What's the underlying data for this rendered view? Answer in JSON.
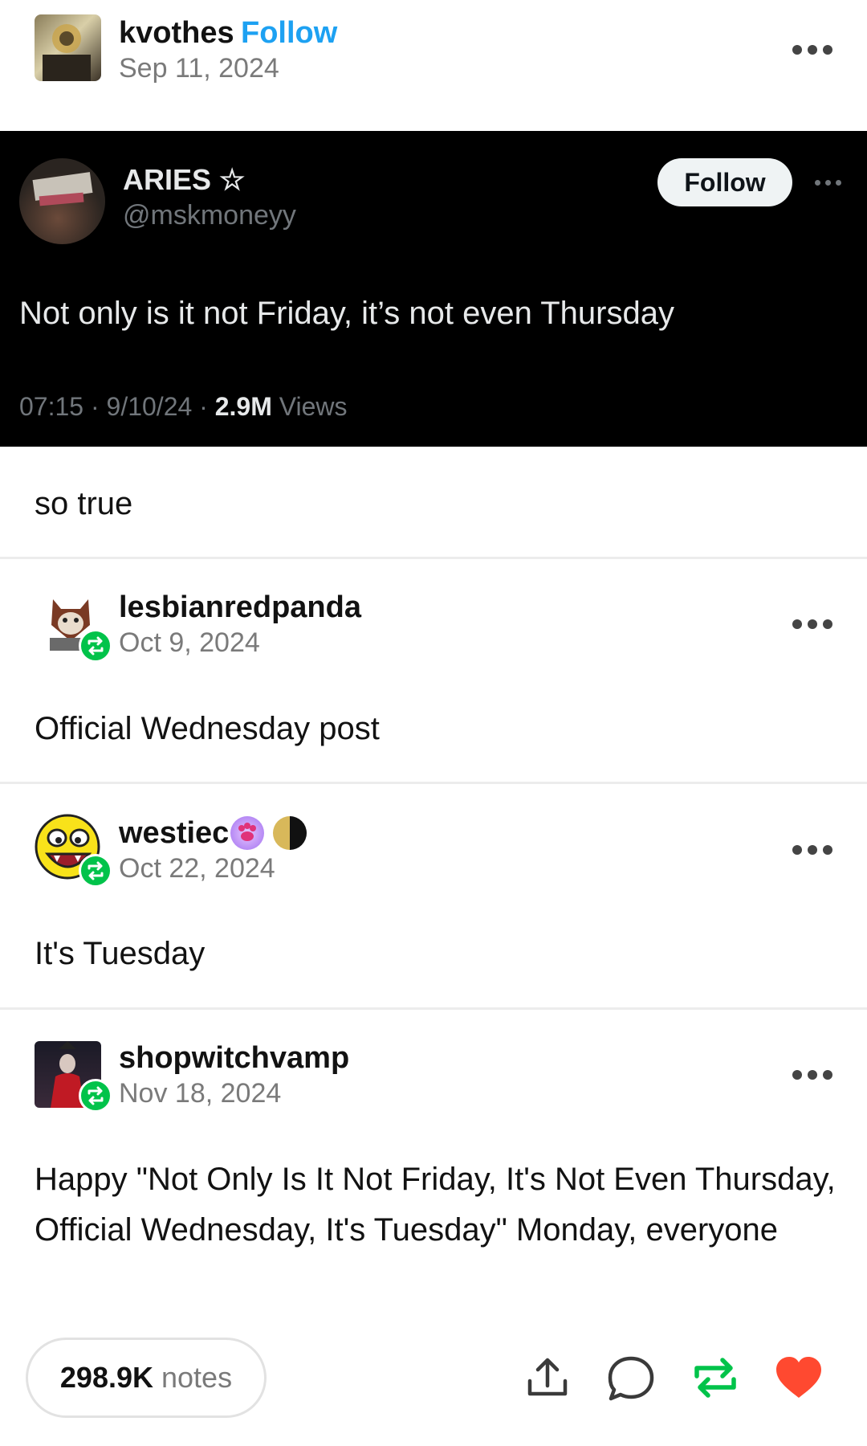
{
  "posts": [
    {
      "username": "kvothes",
      "follow_label": "Follow",
      "date": "Sep 11, 2024",
      "text": "so true"
    },
    {
      "username": "lesbianredpanda",
      "date": "Oct 9, 2024",
      "text": "Official Wednesday post"
    },
    {
      "username": "westiec",
      "date": "Oct 22, 2024",
      "text": "It's Tuesday"
    },
    {
      "username": "shopwitchvamp",
      "date": "Nov 18, 2024",
      "text": "Happy \"Not Only Is It Not Friday, It's Not Even Thursday, Official Wednesday, It's Tuesday\" Monday, everyone"
    }
  ],
  "tweet": {
    "name": "ARIES ☆",
    "handle": "@mskmoneyy",
    "follow_label": "Follow",
    "text": "Not only is it not Friday, it’s not even Thursday",
    "time": "07:15 · 9/10/24 · ",
    "views_count": "2.9M",
    "views_label": " Views"
  },
  "footer": {
    "notes_count": "298.9K",
    "notes_label": " notes"
  },
  "icons": [
    "more-options-icon",
    "reblog-badge-icon",
    "share-icon",
    "reply-icon",
    "reblog-icon",
    "like-heart-icon",
    "paw-badge-icon",
    "moon-badge-icon"
  ],
  "colors": {
    "follow_link": "#1da1f2",
    "reblog_green": "#01c34a",
    "heart_red": "#ff4930",
    "tweet_bg": "#000000"
  }
}
